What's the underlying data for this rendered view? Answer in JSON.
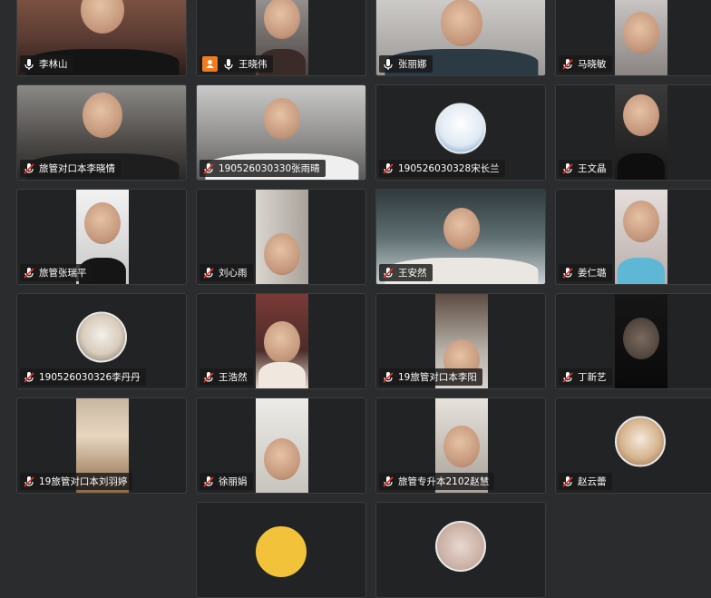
{
  "participants": [
    "李林山",
    "王晓伟",
    "张丽娜",
    "马晓敏",
    "旅管对口本李晓情",
    "190526030330张雨晴",
    "190526030328宋长兰",
    "王文晶",
    "旅管张瑞平",
    "刘心雨",
    "王安然",
    "姜仁璐",
    "190526030326李丹丹",
    "王浩然",
    "19旅管对口本李阳",
    "丁新艺",
    "19旅管对口本刘羽婷",
    "徐丽娟",
    "旅管专升本2102赵慧",
    "赵云蕾"
  ],
  "colors": {
    "background": "#2b2c2e",
    "tile": "#222325",
    "mic_muted": "#e0342b",
    "host_badge": "#f07b21"
  },
  "icons": [
    "mic-muted-icon",
    "mic-on-icon",
    "host-icon"
  ]
}
